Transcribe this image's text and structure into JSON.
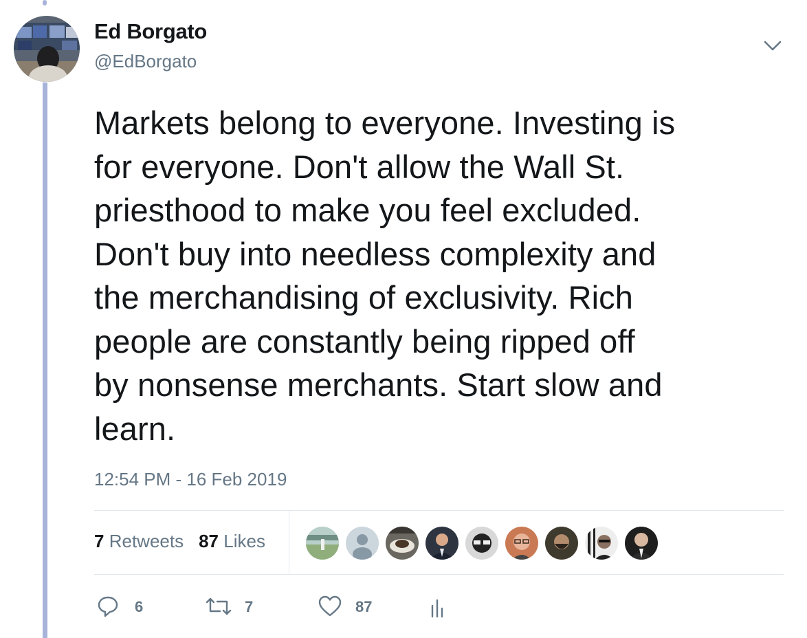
{
  "author": {
    "display_name": "Ed Borgato",
    "handle": "@EdBorgato",
    "avatar_icon": "profile-photo-trading-desk"
  },
  "tweet": {
    "text": "Markets belong to everyone. Investing is\nfor everyone. Don't allow the Wall St.\npriesthood to make you feel excluded.\nDon't buy into needless complexity and\nthe merchandising of exclusivity. Rich\npeople are constantly being ripped off\nby nonsense merchants. Start slow and\nlearn.",
    "timestamp": "12:54 PM - 16 Feb 2019"
  },
  "stats": {
    "retweets_count": "7",
    "retweets_label": "Retweets",
    "likes_count": "87",
    "likes_label": "Likes"
  },
  "liker_avatars": [
    {
      "icon": "avatar-beach"
    },
    {
      "icon": "avatar-default"
    },
    {
      "icon": "avatar-coffee"
    },
    {
      "icon": "avatar-man-suit"
    },
    {
      "icon": "avatar-bw-glasses"
    },
    {
      "icon": "avatar-man-glasses"
    },
    {
      "icon": "avatar-bearded-man"
    },
    {
      "icon": "avatar-sunglasses-bw"
    },
    {
      "icon": "avatar-bald-man-suit"
    }
  ],
  "actions": {
    "reply_count": "6",
    "retweet_count": "7",
    "like_count": "87"
  },
  "colors": {
    "text_primary": "#14171a",
    "text_secondary": "#657786",
    "divider": "#e1e8ed",
    "thread_line": "#a8b3d9"
  }
}
